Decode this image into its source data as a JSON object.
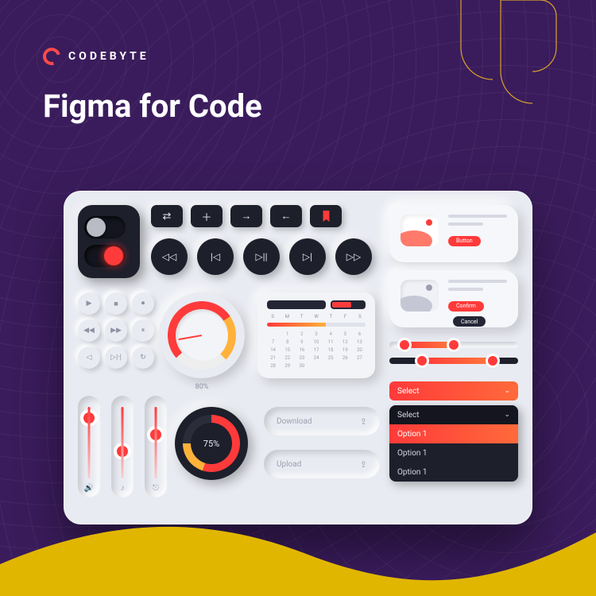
{
  "brand": {
    "name": "CODEBYTE"
  },
  "heading": "Figma for Code",
  "toggles": {
    "off_state": false,
    "on_state": true
  },
  "pills": {
    "shuffle": "⇄",
    "plus": "＋",
    "right": "→",
    "left": "←",
    "bookmark": "bookmark"
  },
  "media": {
    "rewind": "◁◁",
    "prev": "|◁",
    "playpause": "▷||",
    "next": "▷|",
    "ffwd": "▷▷"
  },
  "mini": [
    "▶",
    "■",
    "⏺",
    "◀◀",
    "▶▶",
    "⏸",
    "◁",
    "▷|·|",
    "↻"
  ],
  "gauge": {
    "percent": "80%"
  },
  "calendar": {
    "days": [
      "S",
      "M",
      "T",
      "W",
      "T",
      "F",
      "S"
    ],
    "cells": [
      "",
      "1",
      "2",
      "3",
      "4",
      "5",
      "6",
      "7",
      "8",
      "9",
      "10",
      "11",
      "12",
      "13",
      "14",
      "15",
      "16",
      "17",
      "18",
      "19",
      "20",
      "21",
      "22",
      "23",
      "24",
      "25",
      "26",
      "27",
      "28",
      "29",
      "30",
      ""
    ]
  },
  "ring": {
    "percent": "75%"
  },
  "inputs": {
    "download": "Download",
    "upload": "Upload"
  },
  "vsliders": {
    "vol_icon": "🔊",
    "music_icon": "♪",
    "levels_icon": "⎋"
  },
  "cards": {
    "c1_btn": "Button",
    "c2_btn1": "Confirm",
    "c2_btn2": "Cancel"
  },
  "select": {
    "label": "Select",
    "option": "Option 1",
    "chev": "⌄"
  }
}
